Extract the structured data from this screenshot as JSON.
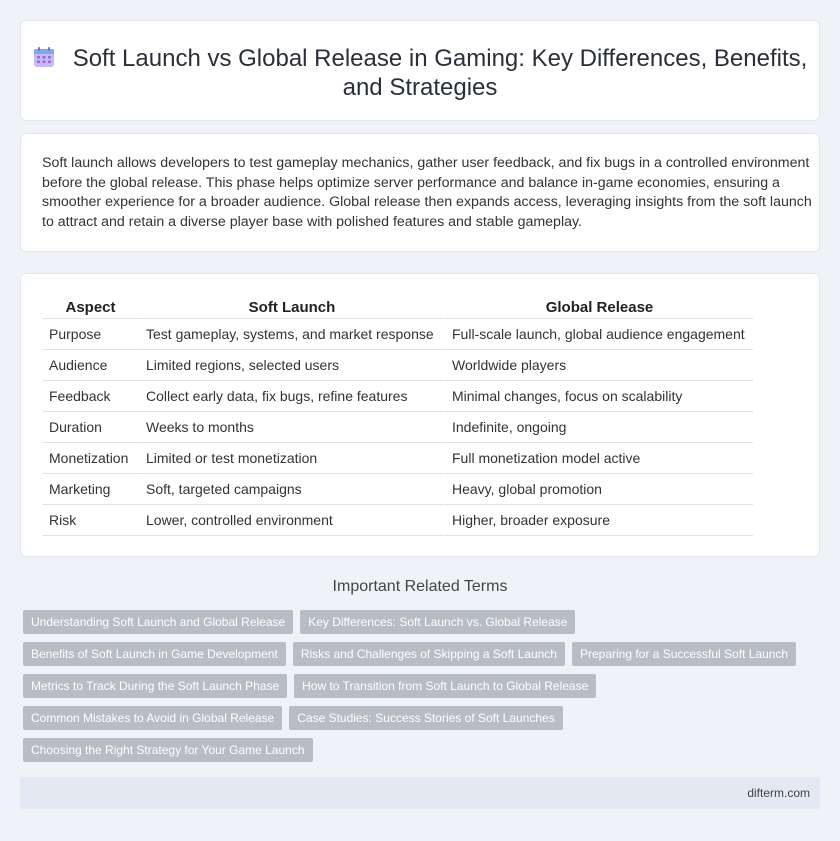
{
  "header": {
    "title": "Soft Launch vs Global Release in Gaming: Key Differences, Benefits, and Strategies",
    "icon": "calendar-icon"
  },
  "intro": {
    "text": "Soft launch allows developers to test gameplay mechanics, gather user feedback, and fix bugs in a controlled environment before the global release. This phase helps optimize server performance and balance in-game economies, ensuring a smoother experience for a broader audience. Global release then expands access, leveraging insights from the soft launch to attract and retain a diverse player base with polished features and stable gameplay."
  },
  "table": {
    "headers": [
      "Aspect",
      "Soft Launch",
      "Global Release"
    ],
    "rows": [
      [
        "Purpose",
        "Test gameplay, systems, and market response",
        "Full-scale launch, global audience engagement"
      ],
      [
        "Audience",
        "Limited regions, selected users",
        "Worldwide players"
      ],
      [
        "Feedback",
        "Collect early data, fix bugs, refine features",
        "Minimal changes, focus on scalability"
      ],
      [
        "Duration",
        "Weeks to months",
        "Indefinite, ongoing"
      ],
      [
        "Monetization",
        "Limited or test monetization",
        "Full monetization model active"
      ],
      [
        "Marketing",
        "Soft, targeted campaigns",
        "Heavy, global promotion"
      ],
      [
        "Risk",
        "Lower, controlled environment",
        "Higher, broader exposure"
      ]
    ]
  },
  "related": {
    "title": "Important Related Terms",
    "tags": [
      [
        "Understanding Soft Launch and Global Release",
        "Key Differences: Soft Launch vs. Global Release"
      ],
      [
        "Benefits of Soft Launch in Game Development",
        "Risks and Challenges of Skipping a Soft Launch",
        "Preparing for a Successful Soft Launch"
      ],
      [
        "Metrics to Track During the Soft Launch Phase",
        "How to Transition from Soft Launch to Global Release"
      ],
      [
        "Common Mistakes to Avoid in Global Release",
        "Case Studies: Success Stories of Soft Launches"
      ],
      [
        "Choosing the Right Strategy for Your Game Launch"
      ]
    ]
  },
  "footer": {
    "site": "difterm.com"
  },
  "colors": {
    "background": "#eff2f7",
    "tag": "#b8bcc4",
    "footer": "#e3e8f2"
  }
}
